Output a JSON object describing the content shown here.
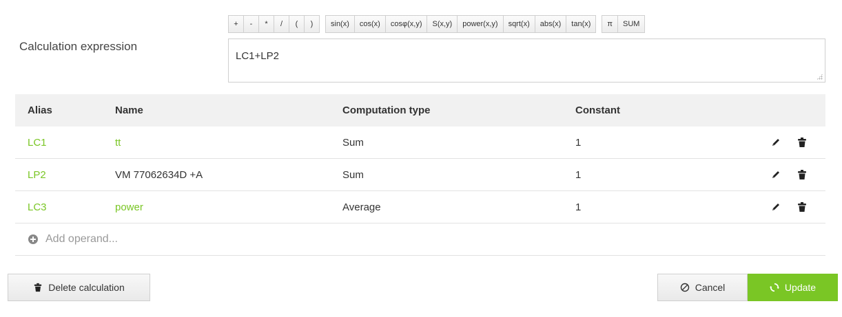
{
  "expression": {
    "label": "Calculation expression",
    "value": "LC1+LP2"
  },
  "toolbar": {
    "operators": [
      "+",
      "-",
      "*",
      "/",
      "(",
      ")"
    ],
    "functions": [
      "sin(x)",
      "cos(x)",
      "cosφ(x,y)",
      "S(x,y)",
      "power(x,y)",
      "sqrt(x)",
      "abs(x)",
      "tan(x)"
    ],
    "constants": [
      "π",
      "SUM"
    ]
  },
  "table": {
    "headers": {
      "alias": "Alias",
      "name": "Name",
      "type": "Computation type",
      "constant": "Constant"
    },
    "rows": [
      {
        "alias": "LC1",
        "name": "tt",
        "type": "Sum",
        "constant": "1",
        "name_color": "#7ac625"
      },
      {
        "alias": "LP2",
        "name": "VM 77062634D +A",
        "type": "Sum",
        "constant": "1",
        "name_color": "#333333"
      },
      {
        "alias": "LC3",
        "name": "power",
        "type": "Average",
        "constant": "1",
        "name_color": "#7ac625"
      }
    ],
    "add_label": "Add operand..."
  },
  "buttons": {
    "delete": "Delete calculation",
    "cancel": "Cancel",
    "update": "Update"
  },
  "colors": {
    "accent": "#7ac625",
    "header_bg": "#f1f1f1"
  },
  "icons": [
    "pencil-icon",
    "trash-icon",
    "plus-circle-icon",
    "cancel-icon",
    "refresh-icon"
  ]
}
